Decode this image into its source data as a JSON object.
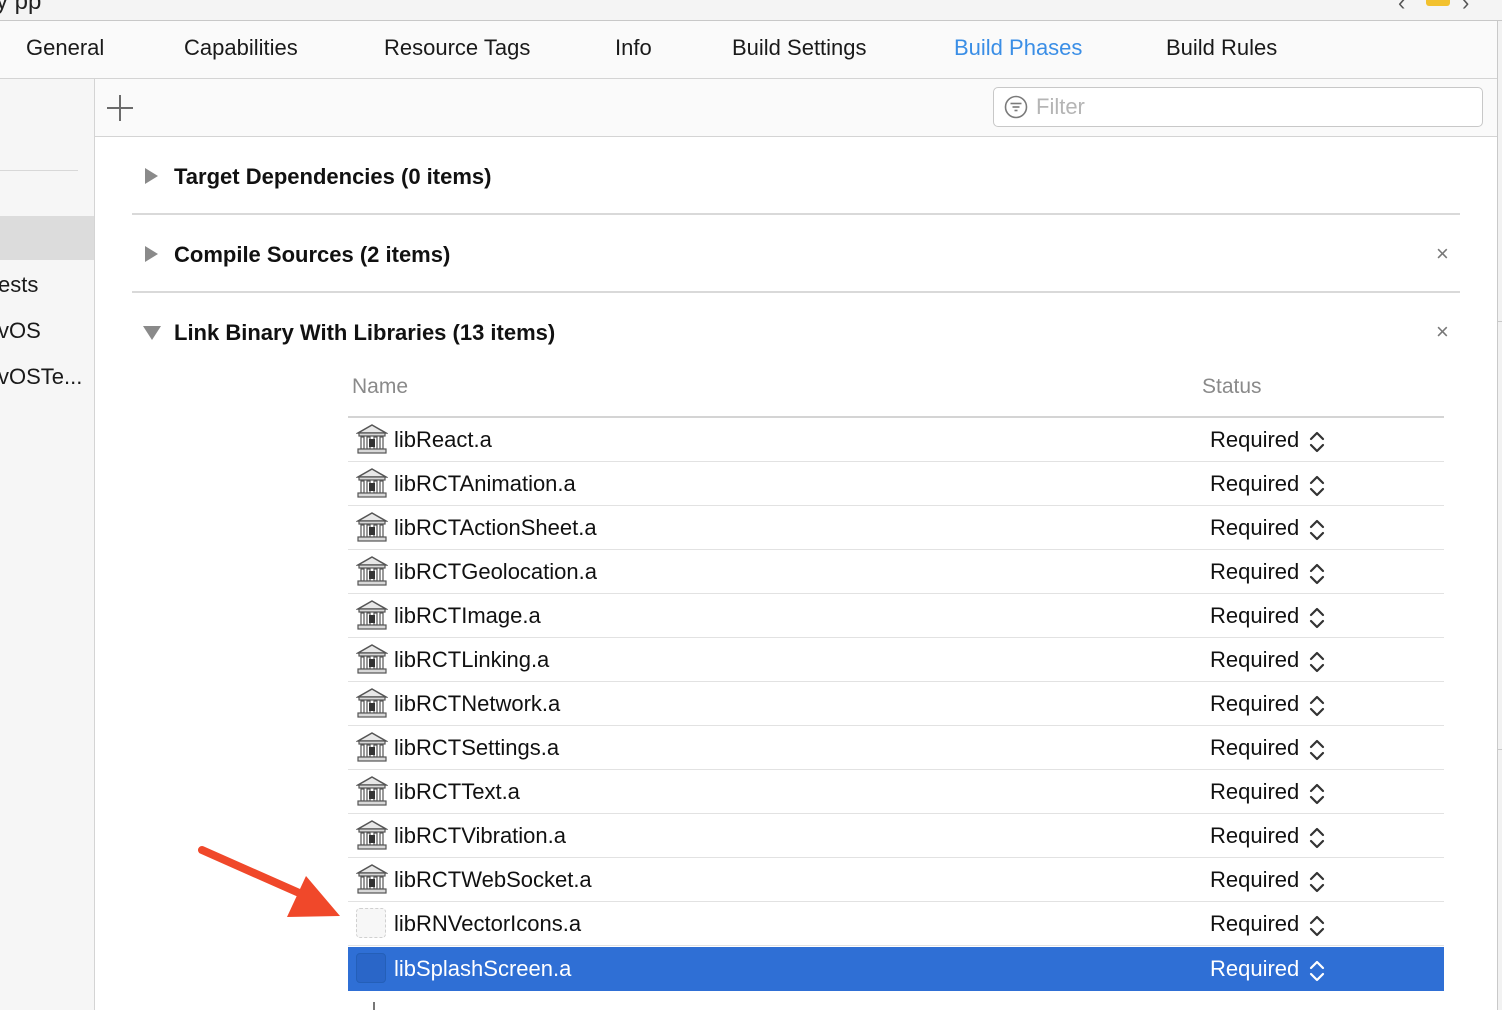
{
  "window": {
    "title_fragment": "y pp"
  },
  "tabs": [
    {
      "label": "General",
      "active": false
    },
    {
      "label": "Capabilities",
      "active": false
    },
    {
      "label": "Resource Tags",
      "active": false
    },
    {
      "label": "Info",
      "active": false
    },
    {
      "label": "Build Settings",
      "active": false
    },
    {
      "label": "Build Phases",
      "active": true
    },
    {
      "label": "Build Rules",
      "active": false
    }
  ],
  "sidebar": {
    "items": [
      {
        "label": "ests"
      },
      {
        "label": "vOS"
      },
      {
        "label": "vOSTe..."
      }
    ]
  },
  "toolbar": {
    "add_symbol": "+",
    "filter_placeholder": "Filter"
  },
  "phases": [
    {
      "title": "Target Dependencies (0 items)",
      "expanded": false,
      "closable": false
    },
    {
      "title": "Compile Sources (2 items)",
      "expanded": false,
      "closable": true
    },
    {
      "title": "Link Binary With Libraries (13 items)",
      "expanded": true,
      "closable": true
    }
  ],
  "close_glyph": "×",
  "library_table": {
    "headers": {
      "name": "Name",
      "status": "Status"
    },
    "rows": [
      {
        "name": "libReact.a",
        "status": "Required",
        "icon": "library-icon"
      },
      {
        "name": "libRCTAnimation.a",
        "status": "Required",
        "icon": "library-icon"
      },
      {
        "name": "libRCTActionSheet.a",
        "status": "Required",
        "icon": "library-icon"
      },
      {
        "name": "libRCTGeolocation.a",
        "status": "Required",
        "icon": "library-icon"
      },
      {
        "name": "libRCTImage.a",
        "status": "Required",
        "icon": "library-icon"
      },
      {
        "name": "libRCTLinking.a",
        "status": "Required",
        "icon": "library-icon"
      },
      {
        "name": "libRCTNetwork.a",
        "status": "Required",
        "icon": "library-icon"
      },
      {
        "name": "libRCTSettings.a",
        "status": "Required",
        "icon": "library-icon"
      },
      {
        "name": "libRCTText.a",
        "status": "Required",
        "icon": "library-icon"
      },
      {
        "name": "libRCTVibration.a",
        "status": "Required",
        "icon": "library-icon"
      },
      {
        "name": "libRCTWebSocket.a",
        "status": "Required",
        "icon": "library-icon"
      },
      {
        "name": "libRNVectorIcons.a",
        "status": "Required",
        "icon": "blank-file-icon"
      },
      {
        "name": "libSplashScreen.a",
        "status": "Required",
        "icon": "blank-file-icon",
        "selected": true
      }
    ]
  },
  "colors": {
    "accent": "#3a8ee6",
    "selection": "#2f6fd5",
    "annotation_arrow": "#f0482a"
  }
}
